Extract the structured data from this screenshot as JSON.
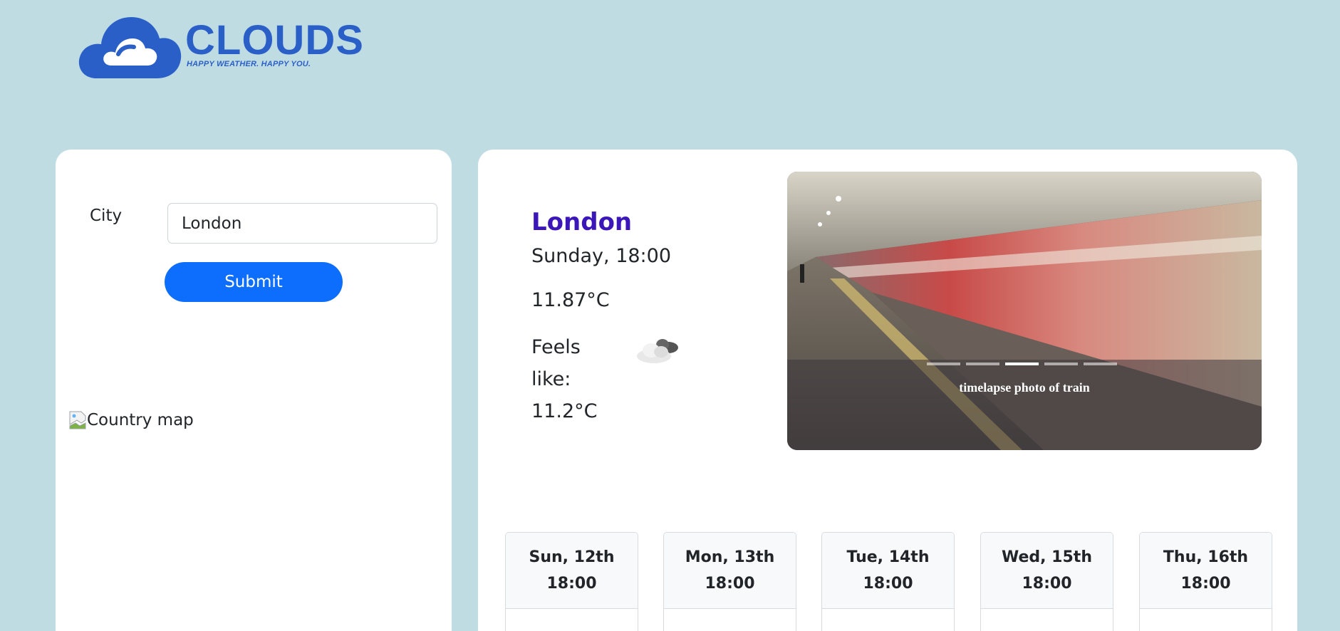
{
  "brand": {
    "name": "CLOUDS",
    "tagline": "HAPPY WEATHER. HAPPY YOU.",
    "color": "#2a5fc8"
  },
  "form": {
    "city_label": "City",
    "city_value": "London",
    "submit_label": "Submit"
  },
  "map": {
    "alt": "Country map"
  },
  "current": {
    "city": "London",
    "datetime": "Sunday, 18:00",
    "temperature": "11.87°C",
    "feels_like": "Feels like: 11.2°C",
    "icon": "cloudy-icon"
  },
  "carousel": {
    "caption": "timelapse photo of train",
    "slide_count": 5,
    "active_index": 2
  },
  "forecast": [
    {
      "day": "Sun, 12th",
      "time": "18:00"
    },
    {
      "day": "Mon, 13th",
      "time": "18:00"
    },
    {
      "day": "Tue, 14th",
      "time": "18:00"
    },
    {
      "day": "Wed, 15th",
      "time": "18:00"
    },
    {
      "day": "Thu, 16th",
      "time": "18:00"
    }
  ],
  "colors": {
    "background": "#c0dce3",
    "city_heading": "#3b16b8",
    "primary_button": "#0d6efd"
  }
}
